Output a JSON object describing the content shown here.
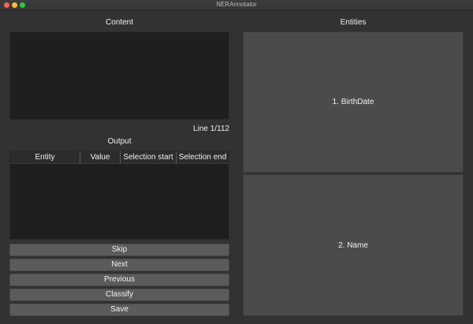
{
  "window": {
    "title": "NERAnnotator"
  },
  "content": {
    "label": "Content",
    "text": ""
  },
  "line_counter": "Line 1/112",
  "output": {
    "label": "Output",
    "columns": [
      "Entity",
      "Value",
      "Selection start",
      "Selection end"
    ],
    "rows": []
  },
  "buttons": {
    "skip": "Skip",
    "next": "Next",
    "previous": "Previous",
    "classify": "Classify",
    "save": "Save"
  },
  "entities": {
    "label": "Entities",
    "items": [
      "1. BirthDate",
      "2. Name"
    ]
  }
}
